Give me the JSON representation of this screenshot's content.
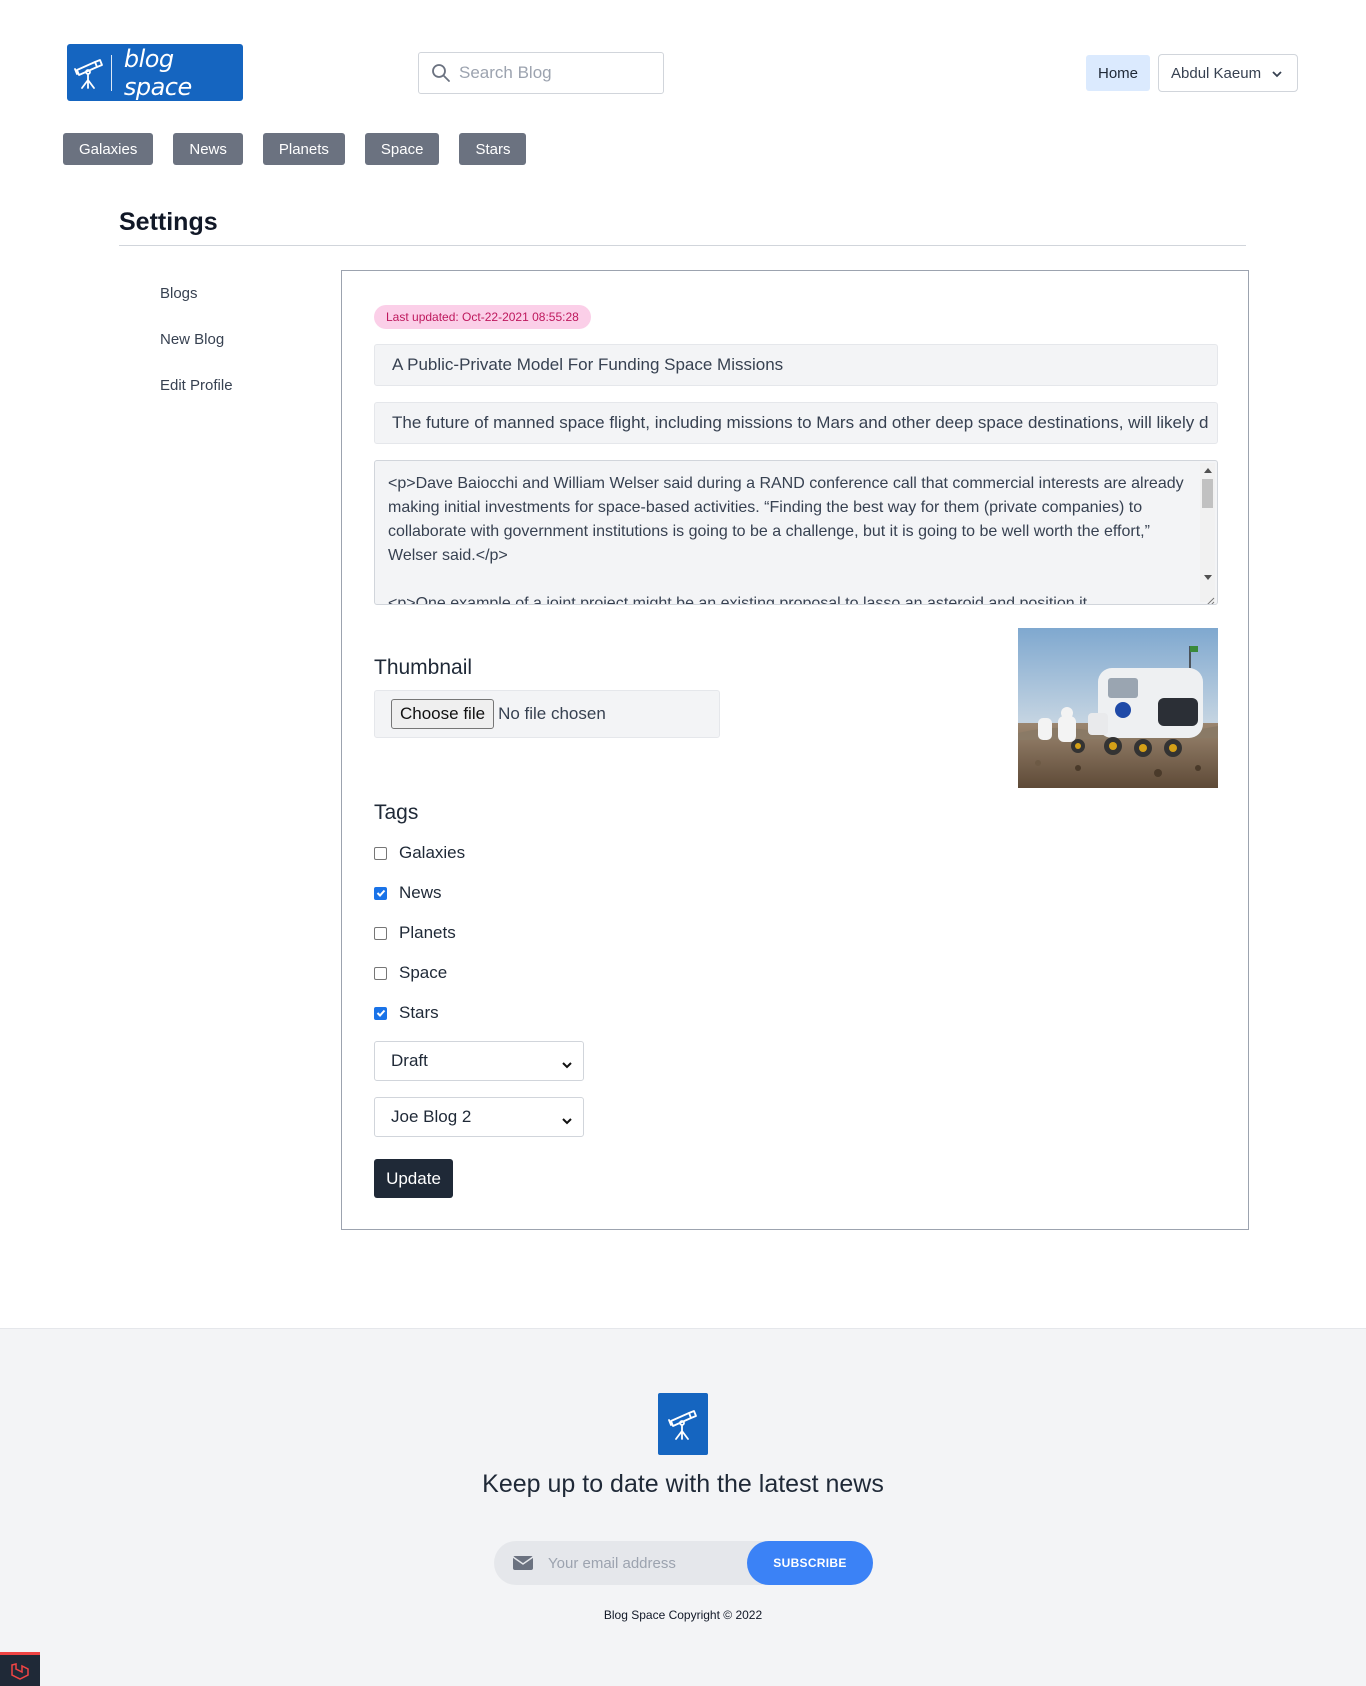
{
  "header": {
    "logo_text": "blog space",
    "search_placeholder": "Search Blog",
    "home_label": "Home",
    "user_name": "Abdul Kaeum"
  },
  "categories": [
    "Galaxies",
    "News",
    "Planets",
    "Space",
    "Stars"
  ],
  "settings": {
    "title": "Settings",
    "nav": [
      "Blogs",
      "New Blog",
      "Edit Profile"
    ]
  },
  "form": {
    "last_updated": "Last updated: Oct-22-2021 08:55:28",
    "title_value": "A Public-Private Model For Funding Space Missions",
    "summary_value": "The future of manned space flight, including missions to Mars and other deep space destinations, will likely d",
    "body_paragraphs": [
      "<p>Dave Baiocchi and William Welser said during a RAND conference call that commercial interests are already making initial investments for space-based activities. “Finding the best way for them (private companies) to collaborate with government institutions is going to be a challenge, but it is going to be well worth the effort,” Welser said.</p>",
      "<p>One example of a joint project might be an existing proposal to lasso an asteroid and position it"
    ],
    "thumbnail_label": "Thumbnail",
    "choose_file_label": "Choose file",
    "file_status": "No file chosen",
    "tags_label": "Tags",
    "tags": [
      {
        "label": "Galaxies",
        "checked": false
      },
      {
        "label": "News",
        "checked": true
      },
      {
        "label": "Planets",
        "checked": false
      },
      {
        "label": "Space",
        "checked": false
      },
      {
        "label": "Stars",
        "checked": true
      }
    ],
    "status_selected": "Draft",
    "author_selected": "Joe Blog 2",
    "update_label": "Update"
  },
  "footer": {
    "heading": "Keep up to date with the latest news",
    "email_placeholder": "Your email address",
    "subscribe_label": "SUBSCRIBE",
    "copyright": "Blog Space Copyright © 2022"
  },
  "colors": {
    "brand_blue": "#1565c0",
    "tag_gray": "#6b7280",
    "badge_pink": "#fbcfe8",
    "subscribe_blue": "#3b82f6",
    "update_dark": "#1f2937"
  }
}
